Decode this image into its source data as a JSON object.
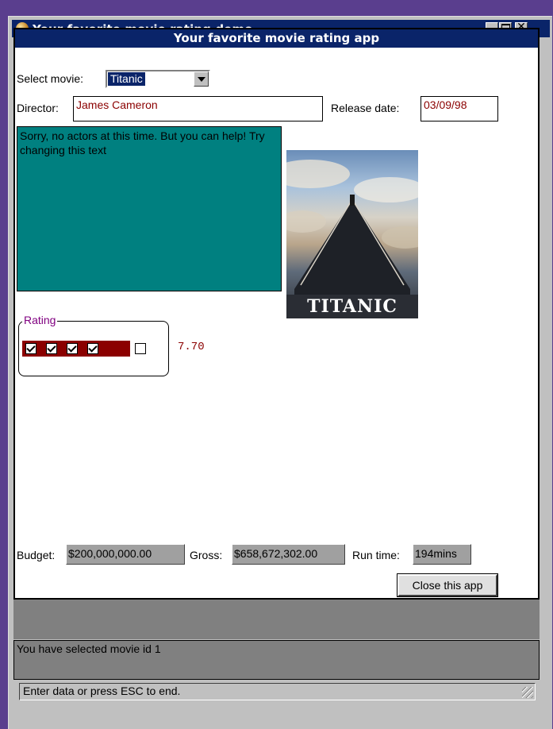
{
  "window": {
    "title": "Your favorite movie rating demo",
    "close_glyph": "✕"
  },
  "app": {
    "header": "Your favorite movie rating app"
  },
  "form": {
    "select_movie_label": "Select movie:",
    "selected_movie": "Titanic",
    "director_label": "Director:",
    "director_value": "James Cameron",
    "release_label": "Release date:",
    "release_value": "03/09/98",
    "actors_text": "Sorry, no actors at this time. But you can help! Try changing this text",
    "poster_title": "TITANIC",
    "rating_label": "Rating",
    "rating_value": "7.70",
    "rating_checked": [
      true,
      true,
      true,
      true,
      false
    ],
    "budget_label": "Budget:",
    "budget_value": "$200,000,000.00",
    "gross_label": "Gross:",
    "gross_value": "$658,672,302.00",
    "runtime_label": "Run time:",
    "runtime_value": "194mins",
    "close_button": "Close this app"
  },
  "status": {
    "message": "You have selected movie id 1",
    "bar_text": "Enter data or press ESC to end."
  },
  "colors": {
    "title_bar": "#0a2469",
    "actors_bg": "#008080",
    "rating_bg": "#8b0000",
    "value_text": "#8b0000",
    "rating_legend": "#800080"
  }
}
